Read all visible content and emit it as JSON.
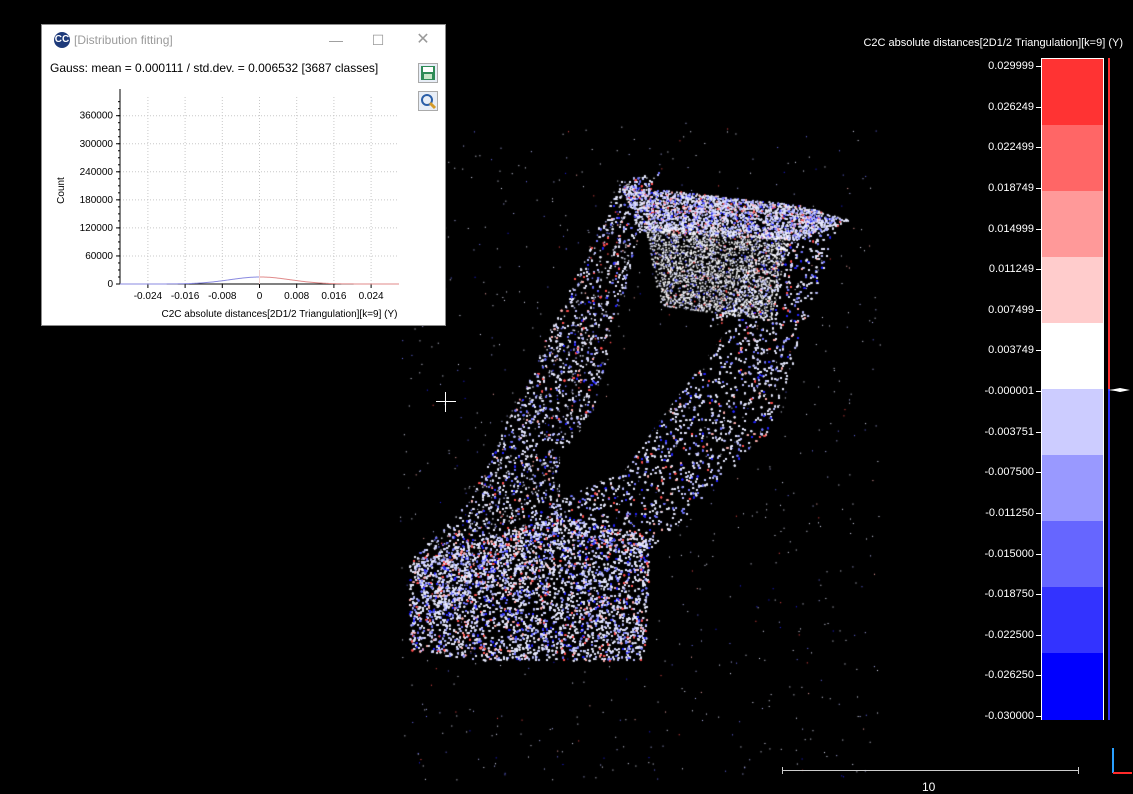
{
  "viewport": {
    "scale_title": "C2C absolute distances[2D1/2 Triangulation][k=9] (Y)",
    "scale_labels": [
      "0.029999",
      "0.026249",
      "0.022499",
      "0.018749",
      "0.014999",
      "0.011249",
      "0.007499",
      "0.003749",
      "-0.000001",
      "-0.003751",
      "-0.007500",
      "-0.011250",
      "-0.015000",
      "-0.018750",
      "-0.022500",
      "-0.026250",
      "-0.030000"
    ],
    "scale_colors": [
      "#ff3333",
      "#ff6666",
      "#ff9999",
      "#ffcccc",
      "#ffffff",
      "#ccccff",
      "#9999ff",
      "#6666ff",
      "#3333ff",
      "#0000ff"
    ],
    "ruler_label": "10"
  },
  "dialog": {
    "title": "[Distribution fitting]",
    "app_icon": "CC",
    "minimize_glyph": "—",
    "maximize_glyph": "☐",
    "close_glyph": "✕",
    "gauss_text": "Gauss: mean = 0.000111 / std.dev. = 0.006532 [3687 classes]",
    "save_icon": "save-icon",
    "zoom_icon": "zoom-icon"
  },
  "chart_data": {
    "type": "bar",
    "xlabel": "C2C absolute distances[2D1/2 Triangulation][k=9] (Y)",
    "ylabel": "Count",
    "xlim": [
      -0.03,
      0.03
    ],
    "ylim": [
      0,
      400000
    ],
    "x_ticks": [
      "-0.024",
      "-0.016",
      "-0.008",
      "0",
      "0.008",
      "0.016",
      "0.024"
    ],
    "x_tick_values": [
      -0.024,
      -0.016,
      -0.008,
      0,
      0.008,
      0.016,
      0.024
    ],
    "y_ticks": [
      "0",
      "60000",
      "120000",
      "180000",
      "240000",
      "300000",
      "360000"
    ],
    "y_tick_values": [
      0,
      60000,
      120000,
      180000,
      240000,
      300000,
      360000
    ],
    "grid": true,
    "fit": {
      "name": "Gauss",
      "mean": 0.000111,
      "std": 0.006532
    },
    "peak_x": 0.0,
    "peak_y": 30000
  }
}
